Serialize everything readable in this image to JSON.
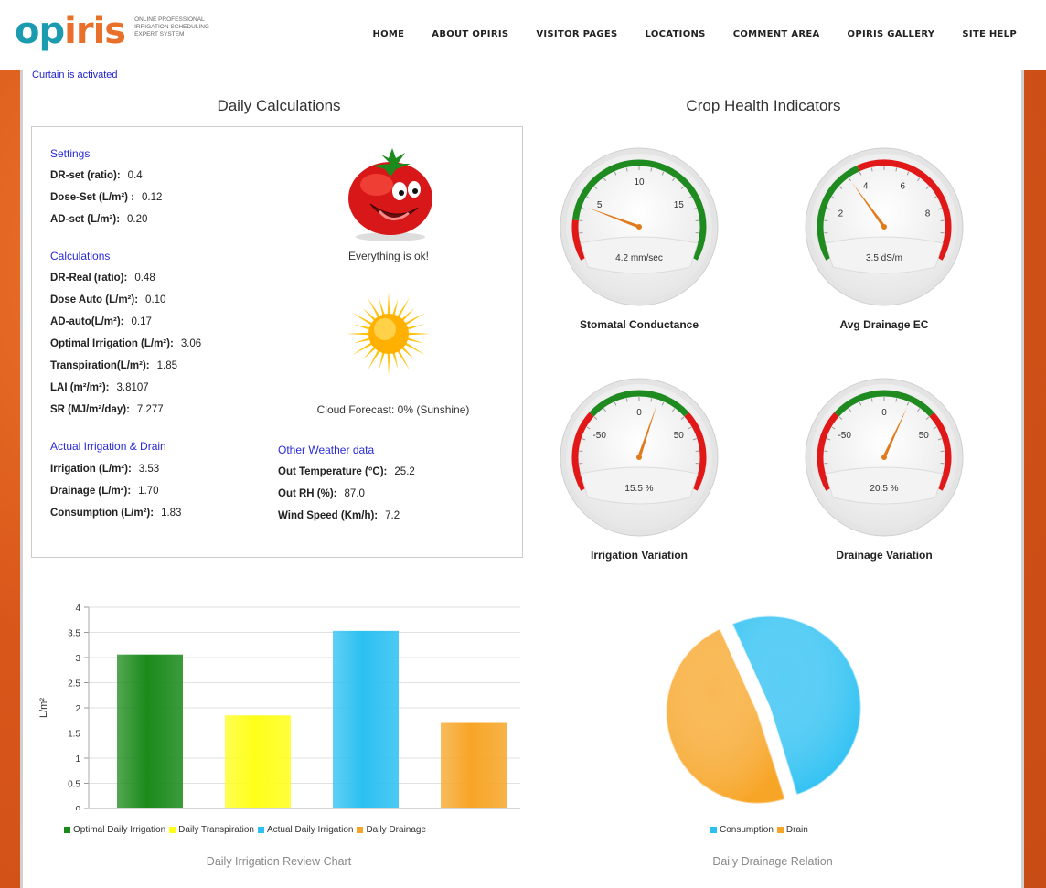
{
  "brand": {
    "logo_left": "op",
    "logo_right": "iris",
    "tagline": [
      "ONLINE PROFESSIONAL",
      "IRRIGATION SCHEDULING",
      "EXPERT SYSTEM"
    ]
  },
  "nav": [
    "HOME",
    "ABOUT OPIRIS",
    "VISITOR PAGES",
    "LOCATIONS",
    "COMMENT AREA",
    "OPIRIS GALLERY",
    "SITE HELP"
  ],
  "status": "Curtain is activated",
  "daily": {
    "title": "Daily Calculations",
    "settings_title": "Settings",
    "settings": [
      {
        "label": "DR-set (ratio):",
        "value": "0.4"
      },
      {
        "label": "Dose-Set (L/m²) :",
        "value": "0.12"
      },
      {
        "label": "AD-set (L/m²):",
        "value": "0.20"
      }
    ],
    "calc_title": "Calculations",
    "calculations": [
      {
        "label": "DR-Real (ratio):",
        "value": "0.48"
      },
      {
        "label": "Dose Auto (L/m²):",
        "value": "0.10"
      },
      {
        "label": "AD-auto(L/m²):",
        "value": "0.17"
      },
      {
        "label": "Optimal Irrigation (L/m²):",
        "value": "3.06"
      },
      {
        "label": "Transpiration(L/m²):",
        "value": "1.85"
      },
      {
        "label": "LAI (m²/m²):",
        "value": "3.8107"
      },
      {
        "label": "SR (MJ/m²/day):",
        "value": "7.277"
      }
    ],
    "actual_title": "Actual Irrigation & Drain",
    "actual": [
      {
        "label": "Irrigation (L/m²):",
        "value": "3.53"
      },
      {
        "label": "Drainage (L/m²):",
        "value": "1.70"
      },
      {
        "label": "Consumption (L/m²):",
        "value": "1.83"
      }
    ],
    "weather_title": "Other Weather data",
    "weather": [
      {
        "label": "Out Temperature (°C):",
        "value": "25.2"
      },
      {
        "label": "Out RH (%):",
        "value": "87.0"
      },
      {
        "label": "Wind Speed (Km/h):",
        "value": "7.2"
      }
    ],
    "status_text": "Everything is ok!",
    "forecast": "Cloud Forecast: 0% (Sunshine)"
  },
  "crop": {
    "title": "Crop Health Indicators",
    "gauges": [
      {
        "name": "Stomatal Conductance",
        "readout": "4.2 mm/sec",
        "min": 0,
        "max": 20,
        "value": 4.2,
        "ticks": [
          "0",
          "5",
          "10",
          "15",
          "20"
        ],
        "bands": [
          {
            "from": 0,
            "to": 3,
            "color": "#e01818"
          },
          {
            "from": 3,
            "to": 20,
            "color": "#1f8a1f"
          }
        ]
      },
      {
        "name": "Avg Drainage EC",
        "readout": "3.5 dS/m",
        "min": 0,
        "max": 10,
        "value": 3.5,
        "ticks": [
          "0",
          "2",
          "4",
          "6",
          "8",
          "10"
        ],
        "bands": [
          {
            "from": 0,
            "to": 4,
            "color": "#1f8a1f"
          },
          {
            "from": 4,
            "to": 10,
            "color": "#e01818"
          }
        ]
      },
      {
        "name": "Irrigation Variation",
        "readout": "15.5 %",
        "min": -100,
        "max": 100,
        "value": 15.5,
        "ticks": [
          "-100",
          "-50",
          "0",
          "50",
          "100"
        ],
        "bands": [
          {
            "from": -100,
            "to": -40,
            "color": "#e01818"
          },
          {
            "from": -40,
            "to": 40,
            "color": "#1f8a1f"
          },
          {
            "from": 40,
            "to": 100,
            "color": "#e01818"
          }
        ]
      },
      {
        "name": "Drainage Variation",
        "readout": "20.5 %",
        "min": -100,
        "max": 100,
        "value": 20.5,
        "ticks": [
          "-100",
          "-50",
          "0",
          "50",
          "100"
        ],
        "bands": [
          {
            "from": -100,
            "to": -40,
            "color": "#e01818"
          },
          {
            "from": -40,
            "to": 40,
            "color": "#1f8a1f"
          },
          {
            "from": 40,
            "to": 100,
            "color": "#e01818"
          }
        ]
      }
    ]
  },
  "chart_data": [
    {
      "type": "bar",
      "title": "Daily Irrigation Review Chart",
      "ylabel": "L/m²",
      "xlabel": "",
      "ylim": [
        0,
        4
      ],
      "yticks": [
        "0",
        "0.5",
        "1",
        "1.5",
        "2",
        "2.5",
        "3",
        "3.5",
        "4"
      ],
      "categories": [
        "Optimal Daily Irrigation",
        "Daily Transpiration",
        "Actual Daily Irrigation",
        "Daily Drainage"
      ],
      "values": [
        3.06,
        1.85,
        3.53,
        1.7
      ],
      "colors": [
        "#1a8a1a",
        "#ffff1a",
        "#2cc0f2",
        "#f7a527"
      ],
      "grid": true,
      "legend": "bottom"
    },
    {
      "type": "pie",
      "title": "Daily Drainage Relation",
      "categories": [
        "Consumption",
        "Drain"
      ],
      "values": [
        1.83,
        1.7
      ],
      "colors": [
        "#2cc0f2",
        "#f7a527"
      ],
      "legend": "bottom"
    }
  ]
}
